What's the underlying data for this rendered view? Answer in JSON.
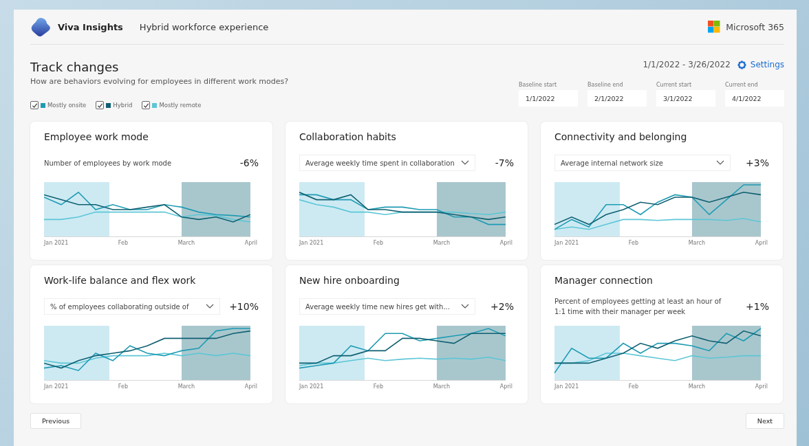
{
  "header": {
    "app_name": "Viva Insights",
    "subtitle": "Hybrid workforce experience",
    "suite": "Microsoft 365"
  },
  "page": {
    "title": "Track changes",
    "description": "How are behaviors evolving for employees in different work modes?",
    "date_range": "1/1/2022 - 3/26/2022",
    "settings": "Settings"
  },
  "legend": [
    {
      "label": "Mostly onsite",
      "checked": true,
      "color": "#1e9bb3"
    },
    {
      "label": "Hybrid",
      "checked": true,
      "color": "#0e5f70"
    },
    {
      "label": "Mostly remote",
      "checked": true,
      "color": "#5cc6d6"
    }
  ],
  "date_fields": [
    {
      "label": "Baseline start",
      "value": "1/1/2022"
    },
    {
      "label": "Baseline end",
      "value": "2/1/2022"
    },
    {
      "label": "Current start",
      "value": "3/1/2022"
    },
    {
      "label": "Current end",
      "value": "4/1/2022"
    }
  ],
  "cards": [
    {
      "title": "Employee work mode",
      "metric": {
        "kind": "label",
        "text": "Number of employees by work mode"
      },
      "change": "-6%",
      "axis_labels": [
        "Jan 2021",
        "Feb",
        "March",
        "April"
      ]
    },
    {
      "title": "Collaboration habits",
      "metric": {
        "kind": "dropdown",
        "text": "Average weekly time spent in collaboration"
      },
      "change": "-7%",
      "axis_labels": [
        "Jan 2021",
        "Feb",
        "March",
        "April"
      ]
    },
    {
      "title": "Connectivity and belonging",
      "metric": {
        "kind": "dropdown",
        "text": "Average internal network size"
      },
      "change": "+3%",
      "axis_labels": [
        "Jan 2021",
        "Feb",
        "March",
        "April"
      ]
    },
    {
      "title": "Work-life balance and flex work",
      "metric": {
        "kind": "dropdown",
        "text": "% of employees collaborating outside of"
      },
      "change": "+10%",
      "axis_labels": [
        "Jan 2021",
        "Feb",
        "March",
        "April"
      ]
    },
    {
      "title": "New hire onboarding",
      "metric": {
        "kind": "dropdown",
        "text": "Average weekly time new hires get with..."
      },
      "change": "+2%",
      "axis_labels": [
        "Jan 2021",
        "Feb",
        "March",
        "April"
      ]
    },
    {
      "title": "Manager connection",
      "metric": {
        "kind": "label",
        "text": "Percent of employees getting at least an hour of 1:1 time with their manager per week"
      },
      "change": "+1%",
      "axis_labels": [
        "Jan 2021",
        "Feb",
        "March",
        "April"
      ]
    }
  ],
  "nav": {
    "previous": "Previous",
    "next": "Next"
  }
}
